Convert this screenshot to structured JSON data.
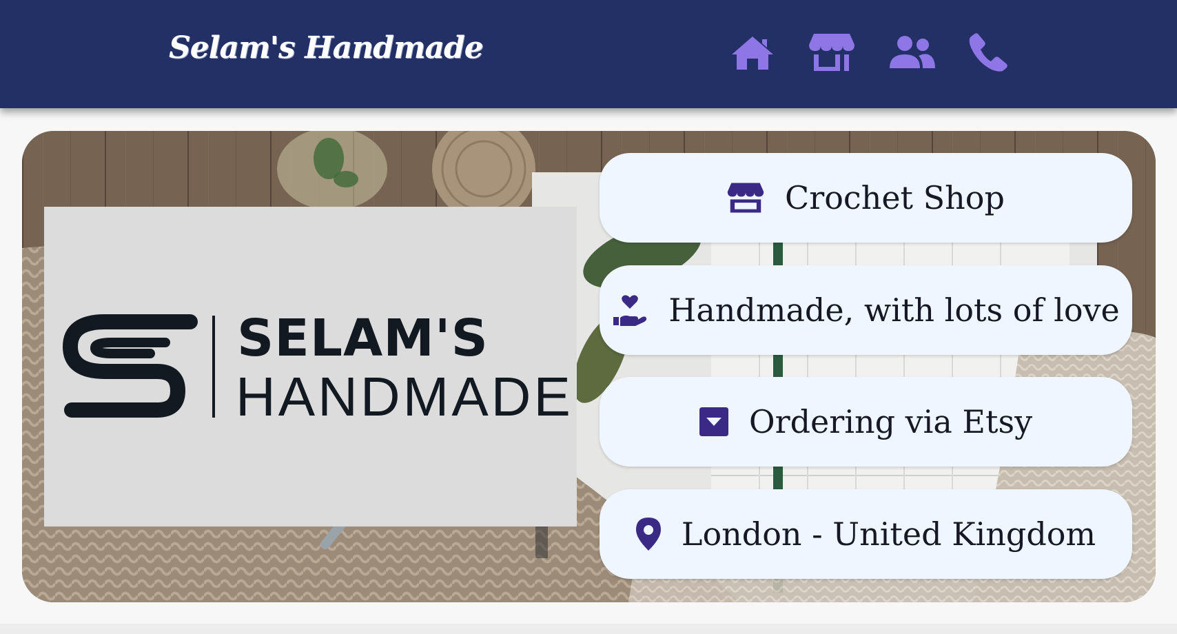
{
  "brand": {
    "name": "Selam's Handmade"
  },
  "nav": [
    {
      "icon": "home-icon"
    },
    {
      "icon": "store-icon"
    },
    {
      "icon": "users-icon"
    },
    {
      "icon": "phone-icon"
    }
  ],
  "logo": {
    "line1": "SELAM'S",
    "line2": "HANDMADE"
  },
  "cards": [
    {
      "icon": "store-icon",
      "label": "Crochet Shop"
    },
    {
      "icon": "hand-holding-heart-icon",
      "label": "Handmade, with lots of love"
    },
    {
      "icon": "dropdown-box-icon",
      "label": "Ordering via Etsy"
    },
    {
      "icon": "map-pin-icon",
      "label": "London - United Kingdom"
    }
  ],
  "colors": {
    "navbar": "#223066",
    "nav_icon": "#8f76e6",
    "card_bg": "#eff6ff",
    "card_icon": "#3a2a86"
  }
}
